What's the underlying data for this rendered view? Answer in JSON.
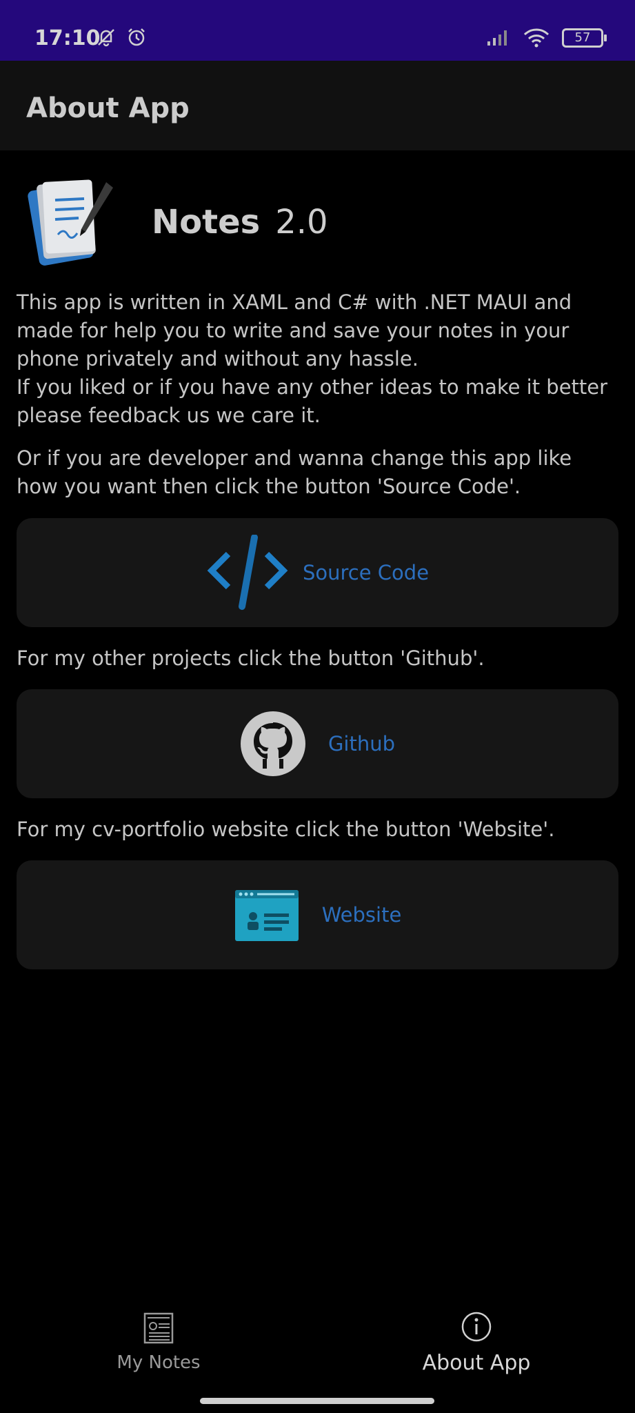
{
  "status_bar": {
    "time": "17:10",
    "battery": "57",
    "background": "#24087c"
  },
  "header": {
    "title": "About App"
  },
  "app": {
    "name": "Notes",
    "version": "2.0",
    "logo_icon": "notebook-pen-icon"
  },
  "description": {
    "paragraph_1": "This app is written in XAML and C# with .NET MAUI and made for help you to write and save your notes in your phone privately and without any hassle.",
    "paragraph_1b": "If you liked or if you have any other ideas to make it better please feedback us we care it.",
    "paragraph_2": "Or if you are developer and wanna change this app like how you want then click the button 'Source Code'.",
    "github_hint": "For my other projects click the button 'Github'.",
    "website_hint": "For my cv-portfolio website click the button 'Website'."
  },
  "links": {
    "source_code": {
      "label": "Source Code",
      "icon": "code-icon"
    },
    "github": {
      "label": "Github",
      "icon": "github-icon"
    },
    "website": {
      "label": "Website",
      "icon": "website-icon"
    },
    "accent": "#2c6fbe"
  },
  "bottom_nav": {
    "items": [
      {
        "label": "My Notes",
        "icon": "notes-icon",
        "active": false
      },
      {
        "label": "About App",
        "icon": "info-icon",
        "active": true
      }
    ]
  }
}
